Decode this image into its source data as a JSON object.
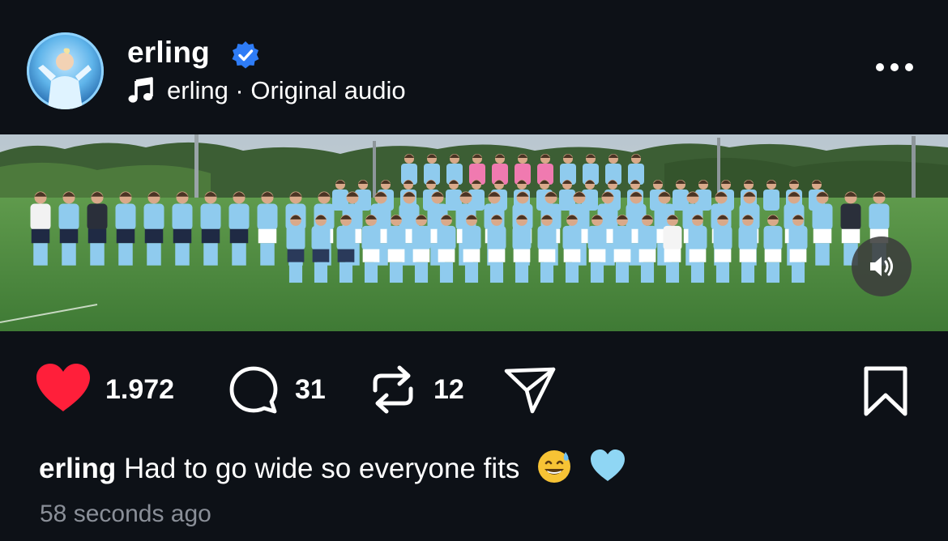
{
  "post": {
    "username": "erling",
    "audio_label": "erling · Original audio",
    "media_alt": "Team photo",
    "stats": {
      "likes": "1.972",
      "comments": "31",
      "reposts": "12"
    },
    "caption": {
      "user": "erling",
      "text": "Had to go wide so everyone fits"
    },
    "timestamp": "58 seconds ago"
  },
  "icons": {
    "verified": "verified-badge-icon",
    "audio": "music-note-icon",
    "more": "more-icon",
    "sound": "volume-icon",
    "like": "heart-icon",
    "comment": "comment-icon",
    "repost": "repost-icon",
    "share": "share-icon",
    "save": "bookmark-icon",
    "emoji_1": "sweat-smile-emoji",
    "emoji_2": "light-blue-heart-emoji"
  },
  "colors": {
    "background": "#0d1117",
    "like": "#ff1f3a",
    "verified": "#2e7cf6",
    "kit_blue": "#8fcbee",
    "keeper_pink": "#f07ab0",
    "muted_text": "#8a8f98"
  }
}
